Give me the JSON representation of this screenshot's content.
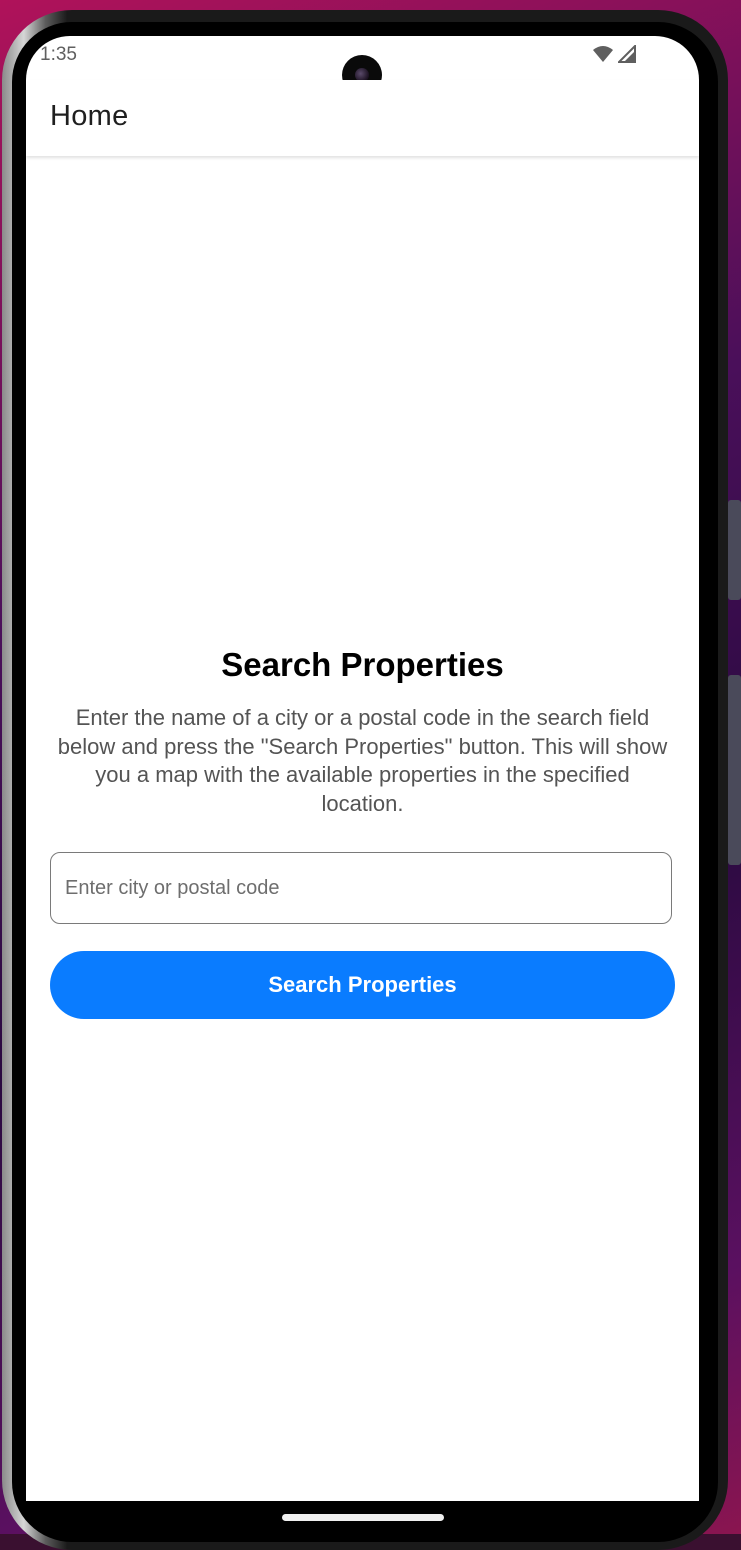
{
  "status_bar": {
    "time": "1:35",
    "icons": [
      "wifi-icon",
      "cellular-signal-icon"
    ]
  },
  "app_bar": {
    "title": "Home"
  },
  "main": {
    "heading": "Search Properties",
    "description": "Enter the name of a city or a postal code in the search field below and press the \"Search Properties\" button. This will show you a map with the available properties in the specified location.",
    "search": {
      "placeholder": "Enter city or postal code",
      "value": ""
    },
    "button_label": "Search Properties"
  },
  "colors": {
    "accent": "#0a7cff",
    "background": "#ffffff",
    "heading": "#000000",
    "body_text": "#545454"
  }
}
